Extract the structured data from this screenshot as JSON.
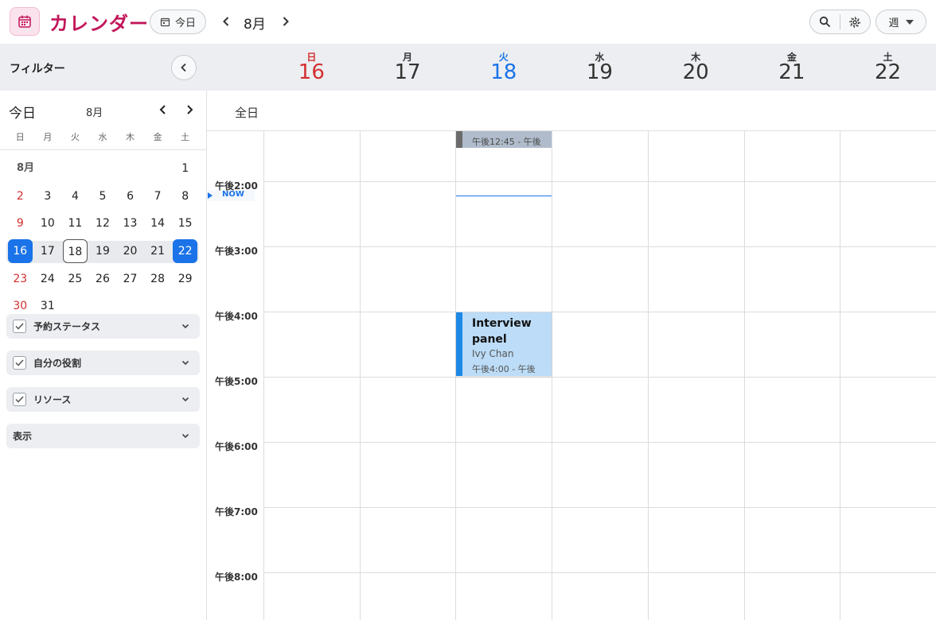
{
  "app": {
    "title": "カレンダー",
    "today_button": "今日",
    "current_month": "8月",
    "view_mode": "週",
    "accent_color": "#c2185b"
  },
  "sidebar": {
    "filter_title": "フィルター",
    "mini_calendar": {
      "today_label": "今日",
      "month_label": "8月",
      "weekdays": [
        "日",
        "月",
        "火",
        "水",
        "木",
        "金",
        "土"
      ],
      "month_name": "8月",
      "weeks": [
        [
          "",
          "",
          "",
          "",
          "",
          "",
          "1"
        ],
        [
          "2",
          "3",
          "4",
          "5",
          "6",
          "7",
          "8"
        ],
        [
          "9",
          "10",
          "11",
          "12",
          "13",
          "14",
          "15"
        ],
        [
          "16",
          "17",
          "18",
          "19",
          "20",
          "21",
          "22"
        ],
        [
          "23",
          "24",
          "25",
          "26",
          "27",
          "28",
          "29"
        ],
        [
          "30",
          "31",
          "",
          "",
          "",
          "",
          ""
        ]
      ],
      "selected_range": [
        "16",
        "22"
      ],
      "today": "18"
    },
    "filters": [
      {
        "label": "予約ステータス",
        "checked": true
      },
      {
        "label": "自分の役割",
        "checked": true
      },
      {
        "label": "リソース",
        "checked": true
      },
      {
        "label": "表示",
        "checked": false
      }
    ]
  },
  "week": {
    "days": [
      {
        "dow": "日",
        "date": "16"
      },
      {
        "dow": "月",
        "date": "17"
      },
      {
        "dow": "火",
        "date": "18"
      },
      {
        "dow": "水",
        "date": "19"
      },
      {
        "dow": "木",
        "date": "20"
      },
      {
        "dow": "金",
        "date": "21"
      },
      {
        "dow": "土",
        "date": "22"
      }
    ],
    "all_day_label": "全日",
    "time_labels": [
      "午後2:00",
      "午後3:00",
      "午後4:00",
      "午後5:00",
      "午後6:00",
      "午後7:00",
      "午後8:00"
    ],
    "now_label": "NOW"
  },
  "events": {
    "partial": {
      "time": "午後12:45 - 午後"
    },
    "interview": {
      "title": "Interview panel",
      "person": "Ivy Chan",
      "time": "午後4:00 - 午後"
    }
  }
}
